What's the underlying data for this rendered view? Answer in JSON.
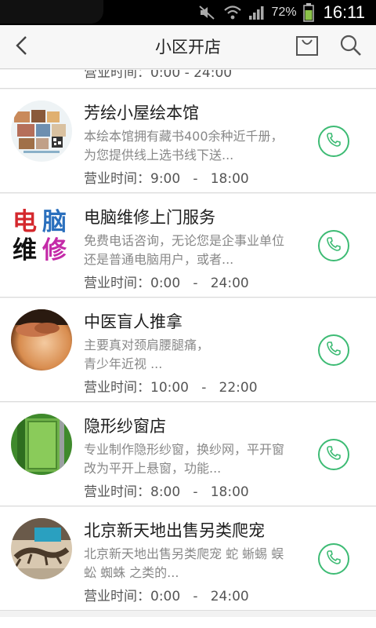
{
  "status_bar": {
    "battery_percent": "72%",
    "time": "16:11",
    "icons": [
      "mute-icon",
      "wifi-icon",
      "signal-icon",
      "battery-icon"
    ]
  },
  "header": {
    "title": "小区开店",
    "back_icon": "chevron-left-icon",
    "bag_icon": "shopping-bag-icon",
    "search_icon": "search-icon"
  },
  "colors": {
    "accent_green": "#3dbb74",
    "status_bar": "#000000",
    "header_bg": "#f7f7f7"
  },
  "list": {
    "partial_top_hours": "营业时间：0:00   -   24:00",
    "items": [
      {
        "name": "芳绘小屋绘本馆",
        "description": "本绘本馆拥有藏书400余种近千册，为您提供线上选书线下送...",
        "hours": "营业时间：9:00   -   18:00",
        "thumb_icon": "picture-book-photo",
        "call_icon": "phone-icon"
      },
      {
        "name": "电脑维修上门服务",
        "description": "免费电话咨询，无论您是企事业单位还是普通电脑用户，或者...",
        "hours": "营业时间：0:00   -   24:00",
        "thumb_text": [
          "电",
          "脑",
          "维",
          "修"
        ],
        "call_icon": "phone-icon"
      },
      {
        "name": "中医盲人推拿",
        "description_lines": [
          "主要真对颈肩腰腿痛，",
          "青少年近视 ..."
        ],
        "hours": "营业时间：10:00   -   22:00",
        "thumb_icon": "massage-photo",
        "call_icon": "phone-icon"
      },
      {
        "name": "隐形纱窗店",
        "description": "专业制作隐形纱窗，换纱网，平开窗改为平开上悬窗，功能...",
        "hours": "营业时间：8:00   -   18:00",
        "thumb_icon": "window-screen-photo",
        "call_icon": "phone-icon"
      },
      {
        "name": "北京新天地出售另类爬宠",
        "description": "北京新天地出售另类爬宠 蛇 蜥蜴 蜈蚣 蜘蛛 之类的...",
        "hours": "营业时间：0:00   -   24:00",
        "thumb_icon": "lizard-photo",
        "call_icon": "phone-icon"
      }
    ]
  }
}
